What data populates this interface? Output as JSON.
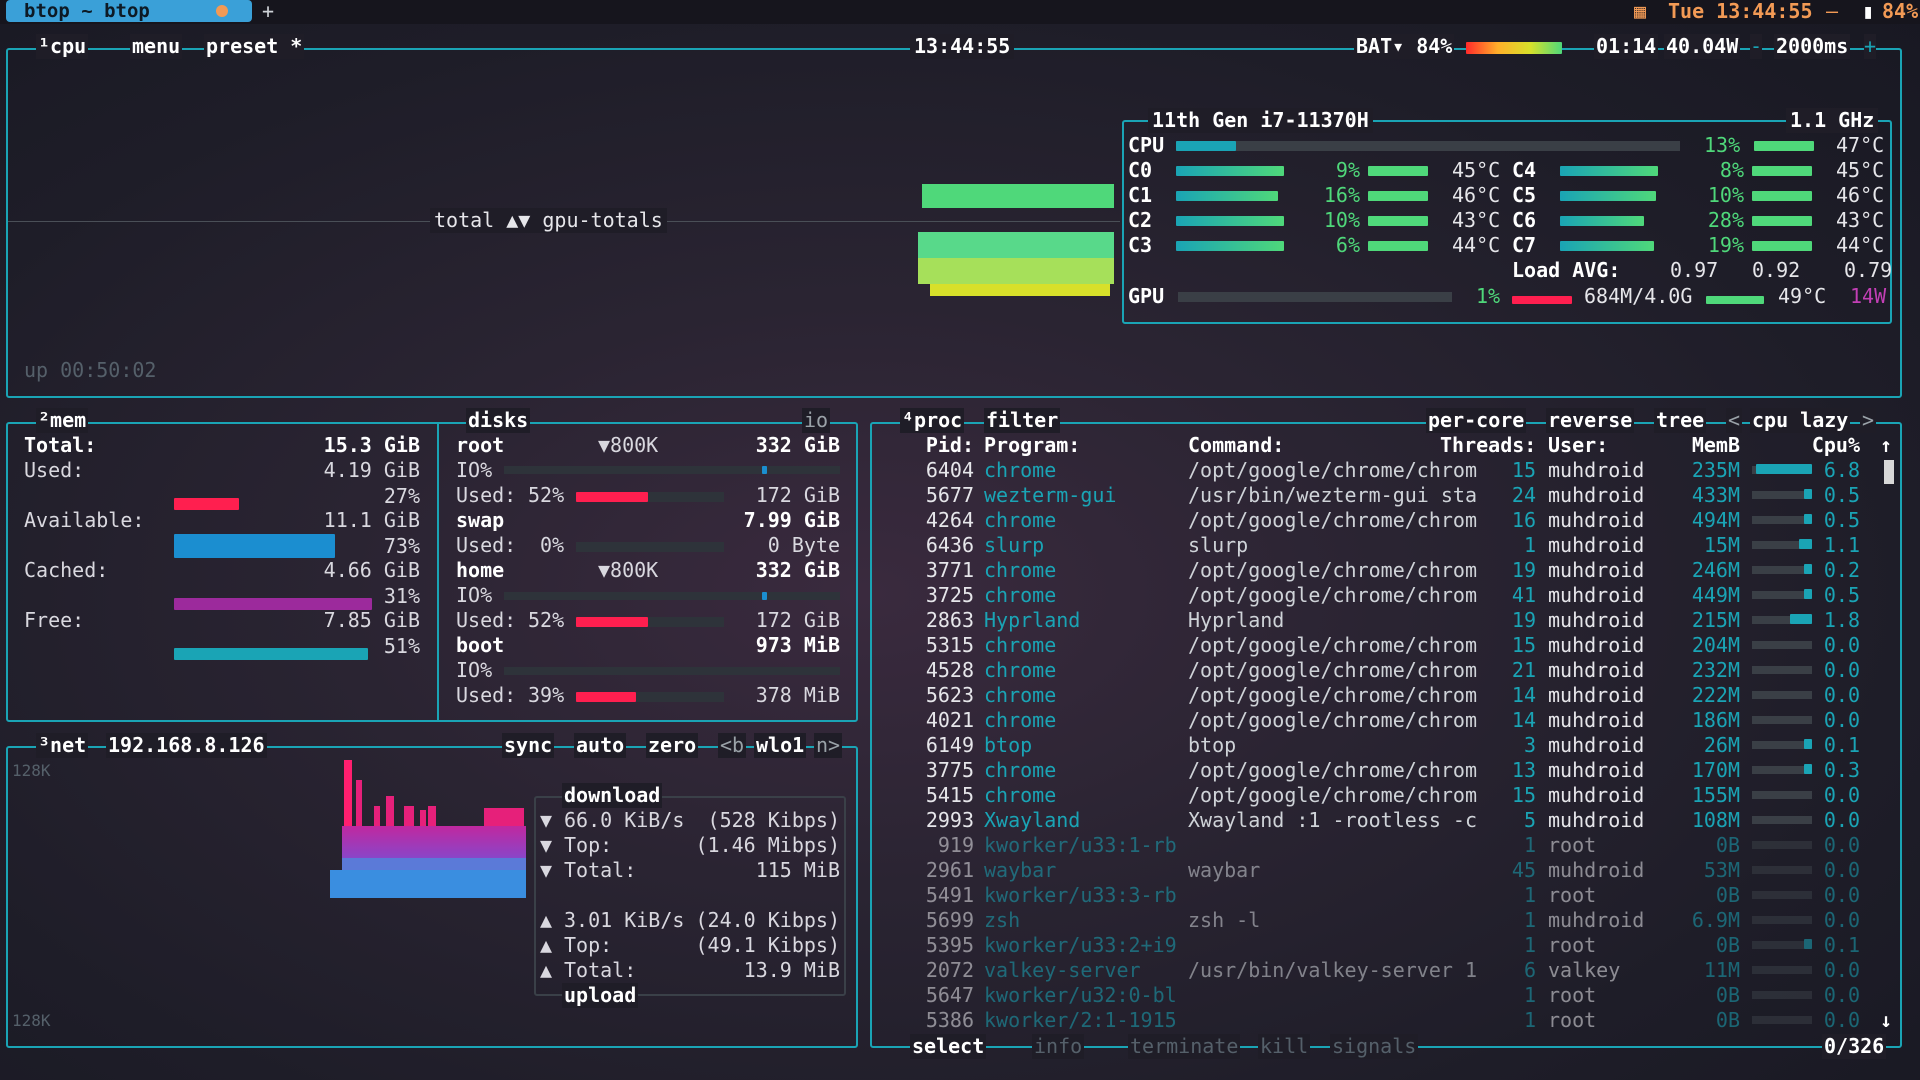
{
  "titlebar": {
    "tab_title": "btop ~ btop",
    "plus": "+",
    "clock": "Tue 13:44:55",
    "dash": "—",
    "battery": "84%"
  },
  "cpu": {
    "box_label": "¹cpu",
    "menu": "menu",
    "preset": "preset *",
    "clock": "13:44:55",
    "bat_label": "BAT▾ 84%",
    "bat_time": "01:14",
    "power": "40.04W",
    "interval": "2000ms",
    "minus": "-",
    "plus": "+",
    "graph_label": "total ▲▼ gpu-totals",
    "uptime": "up 00:50:02",
    "model": "11th Gen i7-11370H",
    "freq": "1.1 GHz",
    "total_label": "CPU",
    "total_pct": "13%",
    "total_temp": "47°C",
    "cores": [
      {
        "name": "C0",
        "pct": "9%",
        "temp": "45°C"
      },
      {
        "name": "C1",
        "pct": "16%",
        "temp": "46°C"
      },
      {
        "name": "C2",
        "pct": "10%",
        "temp": "43°C"
      },
      {
        "name": "C3",
        "pct": "6%",
        "temp": "44°C"
      },
      {
        "name": "C4",
        "pct": "8%",
        "temp": "45°C"
      },
      {
        "name": "C5",
        "pct": "10%",
        "temp": "46°C"
      },
      {
        "name": "C6",
        "pct": "28%",
        "temp": "43°C"
      },
      {
        "name": "C7",
        "pct": "19%",
        "temp": "44°C"
      }
    ],
    "load_label": "Load AVG:",
    "load1": "0.97",
    "load5": "0.92",
    "load15": "0.79",
    "gpu_label": "GPU",
    "gpu_pct": "1%",
    "gpu_mem": "684M/4.0G",
    "gpu_temp": "49°C",
    "gpu_power": "14W"
  },
  "mem": {
    "box_label": "²mem",
    "total_label": "Total:",
    "total": "15.3 GiB",
    "used_label": "Used:",
    "used": "4.19 GiB",
    "used_pct": "27%",
    "avail_label": "Available:",
    "avail": "11.1 GiB",
    "avail_pct": "73%",
    "cached_label": "Cached:",
    "cached": "4.66 GiB",
    "cached_pct": "31%",
    "free_label": "Free:",
    "free": "7.85 GiB",
    "free_pct": "51%",
    "used_fill": 0.27,
    "avail_fill": 0.73,
    "cached_fill": 0.31,
    "free_fill": 0.51
  },
  "disks": {
    "label": "disks",
    "io": "io",
    "root": "root",
    "root_io": "▼800K",
    "root_size": "332 GiB",
    "io_label": "IO%",
    "used_label": "Used:",
    "root_used_pct": "52%",
    "root_used": "172 GiB",
    "swap": "swap",
    "swap_size": "7.99 GiB",
    "swap_used_pct": "0%",
    "swap_used": "0 Byte",
    "home": "home",
    "home_io": "▼800K",
    "home_size": "332 GiB",
    "home_used_pct": "52%",
    "home_used": "172 GiB",
    "boot": "boot",
    "boot_size": "973 MiB",
    "boot_used_pct": "39%",
    "boot_used": "378 MiB"
  },
  "net": {
    "box_label": "³net",
    "ip": "192.168.8.126",
    "sync": "sync",
    "auto": "auto",
    "zero": "zero",
    "iface_prev": "<b",
    "iface": "wlo1",
    "iface_next": "n>",
    "scale_top": "128K",
    "scale_bot": "128K",
    "download_label": "download",
    "dl_rate": "66.0 KiB/s",
    "dl_kbps": "(528 Kibps)",
    "top_label": "Top:",
    "dl_top": "(1.46 Mibps)",
    "total_label": "Total:",
    "dl_total": "115 MiB",
    "ul_rate": "3.01 KiB/s",
    "ul_kbps": "(24.0 Kibps)",
    "ul_top": "(49.1 Kibps)",
    "ul_total": "13.9 MiB",
    "upload_label": "upload"
  },
  "proc": {
    "box_label": "⁴proc",
    "filter": "filter",
    "per_core": "per-core",
    "reverse": "reverse",
    "tree": "tree",
    "sort_prev": "<",
    "sort": "cpu lazy",
    "sort_next": ">",
    "headers": {
      "pid": "Pid:",
      "program": "Program:",
      "command": "Command:",
      "threads": "Threads:",
      "user": "User:",
      "mem": "MemB",
      "cpu": "Cpu%"
    },
    "rows": [
      {
        "pid": "6404",
        "program": "chrome",
        "command": "/opt/google/chrome/chrom",
        "threads": "15",
        "user": "muhdroid",
        "mem": "235M",
        "cpu": "6.8"
      },
      {
        "pid": "5677",
        "program": "wezterm-gui",
        "command": "/usr/bin/wezterm-gui sta",
        "threads": "24",
        "user": "muhdroid",
        "mem": "433M",
        "cpu": "0.5"
      },
      {
        "pid": "4264",
        "program": "chrome",
        "command": "/opt/google/chrome/chrom",
        "threads": "16",
        "user": "muhdroid",
        "mem": "494M",
        "cpu": "0.5"
      },
      {
        "pid": "6436",
        "program": "slurp",
        "command": "slurp",
        "threads": "1",
        "user": "muhdroid",
        "mem": "15M",
        "cpu": "1.1"
      },
      {
        "pid": "3771",
        "program": "chrome",
        "command": "/opt/google/chrome/chrom",
        "threads": "19",
        "user": "muhdroid",
        "mem": "246M",
        "cpu": "0.2"
      },
      {
        "pid": "3725",
        "program": "chrome",
        "command": "/opt/google/chrome/chrom",
        "threads": "41",
        "user": "muhdroid",
        "mem": "449M",
        "cpu": "0.5"
      },
      {
        "pid": "2863",
        "program": "Hyprland",
        "command": "Hyprland",
        "threads": "19",
        "user": "muhdroid",
        "mem": "215M",
        "cpu": "1.8"
      },
      {
        "pid": "5315",
        "program": "chrome",
        "command": "/opt/google/chrome/chrom",
        "threads": "15",
        "user": "muhdroid",
        "mem": "204M",
        "cpu": "0.0"
      },
      {
        "pid": "4528",
        "program": "chrome",
        "command": "/opt/google/chrome/chrom",
        "threads": "21",
        "user": "muhdroid",
        "mem": "232M",
        "cpu": "0.0"
      },
      {
        "pid": "5623",
        "program": "chrome",
        "command": "/opt/google/chrome/chrom",
        "threads": "14",
        "user": "muhdroid",
        "mem": "222M",
        "cpu": "0.0"
      },
      {
        "pid": "4021",
        "program": "chrome",
        "command": "/opt/google/chrome/chrom",
        "threads": "14",
        "user": "muhdroid",
        "mem": "186M",
        "cpu": "0.0"
      },
      {
        "pid": "6149",
        "program": "btop",
        "command": "btop",
        "threads": "3",
        "user": "muhdroid",
        "mem": "26M",
        "cpu": "0.1"
      },
      {
        "pid": "3775",
        "program": "chrome",
        "command": "/opt/google/chrome/chrom",
        "threads": "13",
        "user": "muhdroid",
        "mem": "170M",
        "cpu": "0.3"
      },
      {
        "pid": "5415",
        "program": "chrome",
        "command": "/opt/google/chrome/chrom",
        "threads": "15",
        "user": "muhdroid",
        "mem": "155M",
        "cpu": "0.0"
      },
      {
        "pid": "2993",
        "program": "Xwayland",
        "command": "Xwayland :1 -rootless -c",
        "threads": "5",
        "user": "muhdroid",
        "mem": "108M",
        "cpu": "0.0"
      },
      {
        "pid": "919",
        "program": "kworker/u33:1-rb",
        "command": "",
        "threads": "1",
        "user": "root",
        "mem": "0B",
        "cpu": "0.0"
      },
      {
        "pid": "2961",
        "program": "waybar",
        "command": "waybar",
        "threads": "45",
        "user": "muhdroid",
        "mem": "53M",
        "cpu": "0.0"
      },
      {
        "pid": "5491",
        "program": "kworker/u33:3-rb",
        "command": "",
        "threads": "1",
        "user": "root",
        "mem": "0B",
        "cpu": "0.0"
      },
      {
        "pid": "5699",
        "program": "zsh",
        "command": "zsh -l",
        "threads": "1",
        "user": "muhdroid",
        "mem": "6.9M",
        "cpu": "0.0"
      },
      {
        "pid": "5395",
        "program": "kworker/u33:2+i9",
        "command": "",
        "threads": "1",
        "user": "root",
        "mem": "0B",
        "cpu": "0.1"
      },
      {
        "pid": "2072",
        "program": "valkey-server",
        "command": "/usr/bin/valkey-server 1",
        "threads": "6",
        "user": "valkey",
        "mem": "11M",
        "cpu": "0.0"
      },
      {
        "pid": "5647",
        "program": "kworker/u32:0-bl",
        "command": "",
        "threads": "1",
        "user": "root",
        "mem": "0B",
        "cpu": "0.0"
      },
      {
        "pid": "5386",
        "program": "kworker/2:1-1915",
        "command": "",
        "threads": "1",
        "user": "root",
        "mem": "0B",
        "cpu": "0.0"
      }
    ],
    "select": "select",
    "info": "info",
    "terminate": "terminate",
    "kill": "kill",
    "signals": "signals",
    "count": "0/326"
  },
  "colors": {
    "accent": "#1aa4b5",
    "red": "#ff1f4f",
    "blue": "#1b8ed0",
    "purple": "#9c2a9c",
    "teal": "#1aa4b5",
    "green": "#4fd87a"
  }
}
